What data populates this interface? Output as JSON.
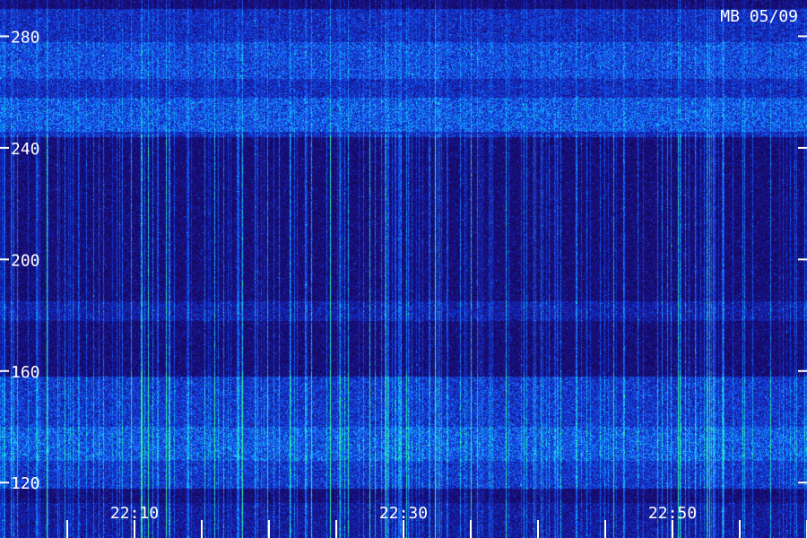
{
  "chart_data": {
    "type": "heatmap",
    "title": "MB 05/09",
    "xlabel": "",
    "ylabel": "",
    "x_ticks": [
      "22:10",
      "22:30",
      "22:50"
    ],
    "x_range": [
      "22:03",
      "23:03"
    ],
    "y_ticks": [
      120,
      160,
      200,
      240,
      280
    ],
    "ylim": [
      113,
      293
    ],
    "grid": false,
    "colormap": [
      "#050020",
      "#1a0a70",
      "#1030d0",
      "#1a70ff",
      "#10d0ff",
      "#30ff90"
    ],
    "bands": [
      {
        "from": 244,
        "to": 290,
        "intensity": 0.55
      },
      {
        "from": 246,
        "to": 258,
        "intensity": 0.75
      },
      {
        "from": 265,
        "to": 278,
        "intensity": 0.7
      },
      {
        "from": 118,
        "to": 158,
        "intensity": 0.6
      },
      {
        "from": 128,
        "to": 140,
        "intensity": 0.75
      },
      {
        "from": 178,
        "to": 185,
        "intensity": 0.45
      }
    ]
  }
}
